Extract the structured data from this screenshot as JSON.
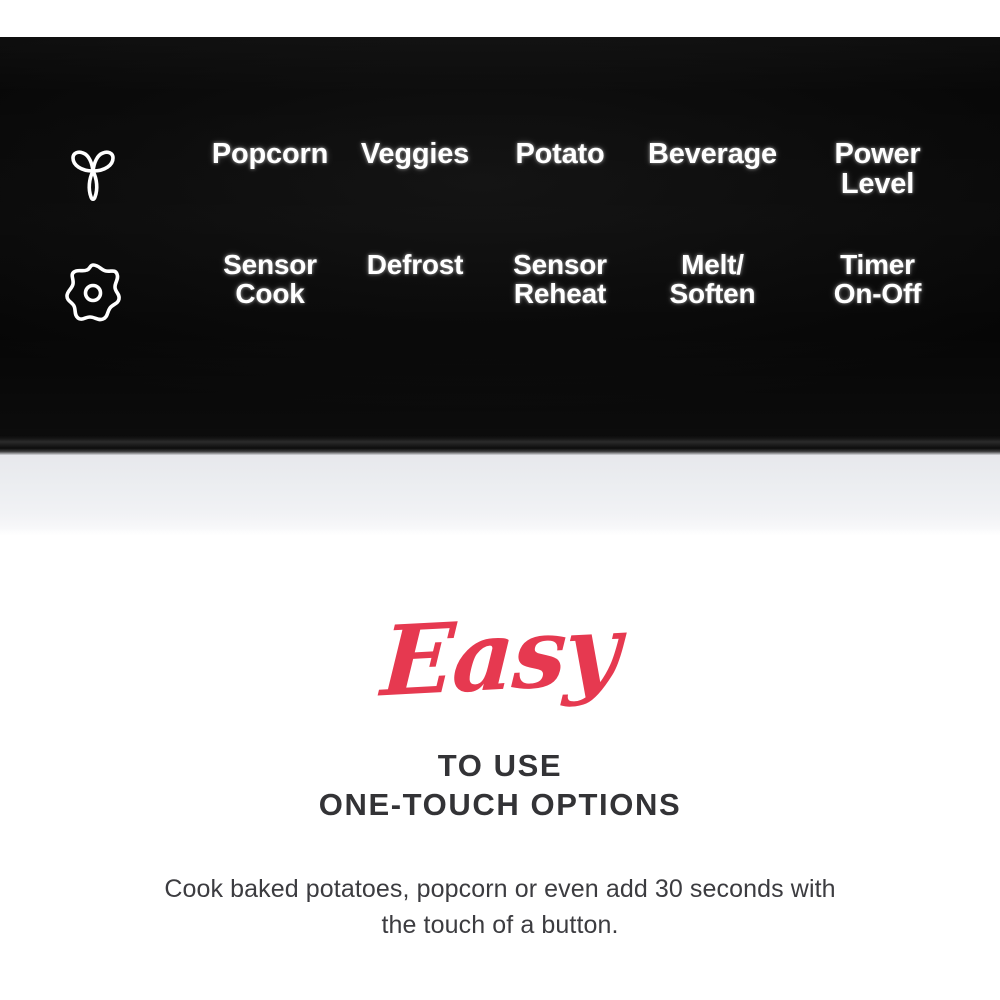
{
  "panel": {
    "background_color": "#080808",
    "label_color": "#ffffff",
    "icons": [
      {
        "name": "sprout-icon",
        "glyph": "three-petal-sprout"
      },
      {
        "name": "gear-icon",
        "glyph": "flower-gear-with-center-dot"
      }
    ],
    "rows": [
      {
        "row_index": 1,
        "buttons": [
          {
            "label": "Popcorn"
          },
          {
            "label": "Veggies"
          },
          {
            "label": "Potato"
          },
          {
            "label": "Beverage"
          },
          {
            "label": "Power\nLevel"
          }
        ]
      },
      {
        "row_index": 2,
        "buttons": [
          {
            "label": "Sensor\nCook"
          },
          {
            "label": "Defrost"
          },
          {
            "label": "Sensor\nReheat"
          },
          {
            "label": "Melt/\nSoften"
          },
          {
            "label": "Timer\nOn-Off"
          }
        ]
      }
    ]
  },
  "promo": {
    "script_word": "Easy",
    "script_color": "#e63950",
    "heading_line_1": "TO USE",
    "heading_line_2": "ONE-TOUCH OPTIONS",
    "heading_color": "#333336",
    "body_text": "Cook baked potatoes, popcorn or even add 30 seconds with the touch of a button.",
    "body_color": "#3c3c40",
    "background_color": "#ffffff"
  }
}
